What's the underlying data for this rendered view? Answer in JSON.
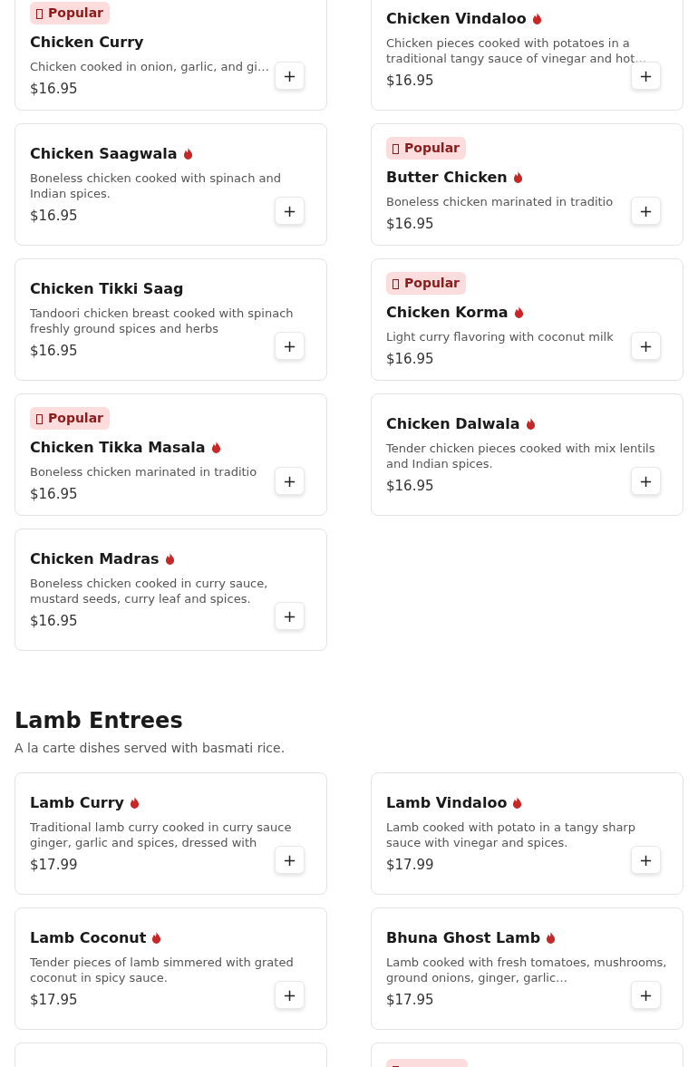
{
  "sections": [
    {
      "items": [
        {
          "popular": true,
          "badge": "Popular",
          "name": "Chicken Curry",
          "spicy": false,
          "description": "Chicken cooked in onion, garlic, and gi…",
          "price": "$16.95",
          "button": "+"
        },
        {
          "popular": false,
          "name": "Chicken Vindaloo",
          "spicy": true,
          "description": "Chicken pieces cooked with potatoes in a traditional tangy sauce of vinegar and hot…",
          "price": "$16.95",
          "button": "+"
        },
        {
          "popular": false,
          "name": "Chicken Saagwala",
          "spicy": true,
          "description": "Boneless chicken cooked with spinach and Indian spices.",
          "price": "$16.95",
          "button": "+"
        },
        {
          "popular": true,
          "badge": "Popular",
          "name": "Butter Chicken",
          "spicy": true,
          "description": "Boneless chicken marinated in traditio",
          "price": "$16.95",
          "button": "+"
        },
        {
          "popular": false,
          "name": "Chicken Tikki Saag",
          "spicy": false,
          "description": "Tandoori chicken breast cooked with spinach freshly ground spices and herbs",
          "price": "$16.95",
          "button": "+"
        },
        {
          "popular": true,
          "badge": "Popular",
          "name": "Chicken Korma",
          "spicy": true,
          "description": "Light curry flavoring with coconut milk",
          "price": "$16.95",
          "button": "+"
        },
        {
          "popular": true,
          "badge": "Popular",
          "name": "Chicken Tikka Masala",
          "spicy": true,
          "description": "Boneless chicken marinated in traditio",
          "price": "$16.95",
          "button": "+"
        },
        {
          "popular": false,
          "name": "Chicken Dalwala",
          "spicy": true,
          "description": "Tender chicken pieces cooked with mix lentils and Indian spices.",
          "price": "$16.95",
          "button": "+"
        },
        {
          "popular": false,
          "name": "Chicken Madras",
          "spicy": true,
          "description": "Boneless chicken cooked in curry sauce, mustard seeds, curry leaf and spices.",
          "price": "$16.95",
          "button": "+"
        }
      ]
    },
    {
      "title": "Lamb Entrees",
      "subtitle": "A la carte dishes served with basmati rice.",
      "items": [
        {
          "popular": false,
          "name": "Lamb Curry",
          "spicy": true,
          "description": "Traditional lamb curry cooked in curry sauce ginger, garlic and spices, dressed with",
          "price": "$17.99",
          "button": "+"
        },
        {
          "popular": false,
          "name": "Lamb Vindaloo",
          "spicy": true,
          "description": "Lamb cooked with potato in a tangy sharp sauce with vinegar and spices.",
          "price": "$17.99",
          "button": "+"
        },
        {
          "popular": false,
          "name": "Lamb Coconut",
          "spicy": true,
          "description": "Tender pieces of lamb simmered with grated coconut in spicy sauce.",
          "price": "$17.95",
          "button": "+"
        },
        {
          "popular": false,
          "name": "Bhuna Ghost Lamb",
          "spicy": true,
          "description": "Lamb cooked with fresh tomatoes, mushrooms, ground onions, ginger, garlic…",
          "price": "$17.95",
          "button": "+"
        },
        {
          "popular": false
        },
        {
          "popular": true
        }
      ]
    }
  ]
}
